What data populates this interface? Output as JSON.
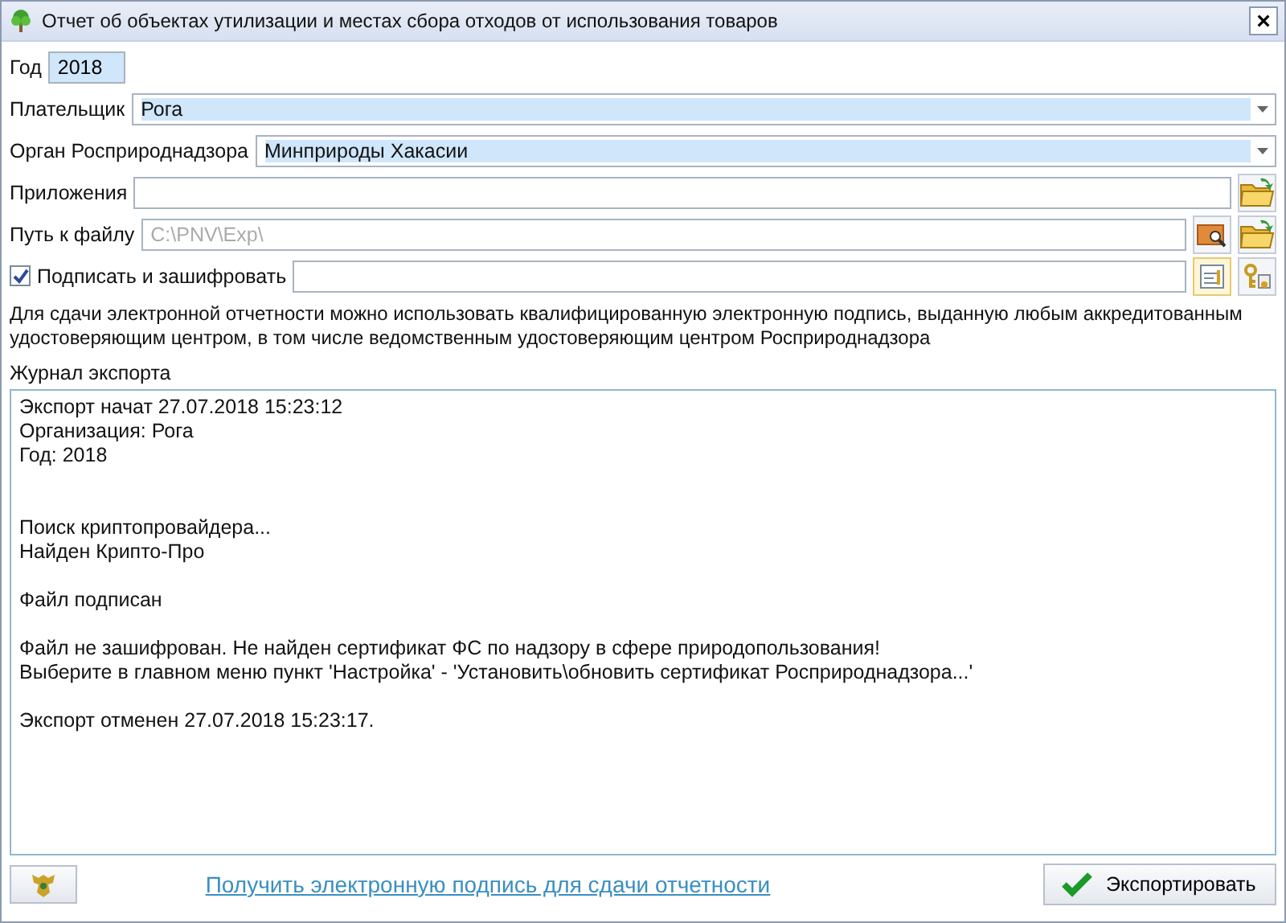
{
  "window": {
    "title": "Отчет об объектах утилизации и местах сбора отходов от использования товаров",
    "close": "×"
  },
  "year": {
    "label": "Год",
    "value": "2018"
  },
  "payer": {
    "label": "Плательщик",
    "value": "Рога"
  },
  "authority": {
    "label": "Орган Росприроднадзора",
    "value": "Минприроды Хакасии"
  },
  "attachments": {
    "label": "Приложения"
  },
  "file_path": {
    "label": "Путь к файлу",
    "placeholder": "C:\\PNV\\Exp\\"
  },
  "sign": {
    "label": "Подписать и зашифровать",
    "checked": true
  },
  "note": "Для сдачи электронной отчетности можно использовать квалифицированную электронную подпись, выданную любым аккредитованным удостоверяющим центром, в том числе ведомственным удостоверяющим центром Росприроднадзора",
  "log": {
    "label": "Журнал экспорта",
    "text": "Экспорт начат 27.07.2018 15:23:12\nОрганизация: Рога\nГод: 2018\n\n\nПоиск криптопровайдера...\nНайден Крипто-Про\n\nФайл подписан\n\nФайл не зашифрован. Не найден сертификат ФС по надзору в сфере природопользования!\nВыберите в главном меню пункт 'Настройка' - 'Установить\\обновить сертификат Росприроднадзора...'\n\nЭкспорт отменен 27.07.2018 15:23:17."
  },
  "footer": {
    "link": "Получить электронную подпись для сдачи отчетности",
    "export_button": "Экспортировать"
  }
}
